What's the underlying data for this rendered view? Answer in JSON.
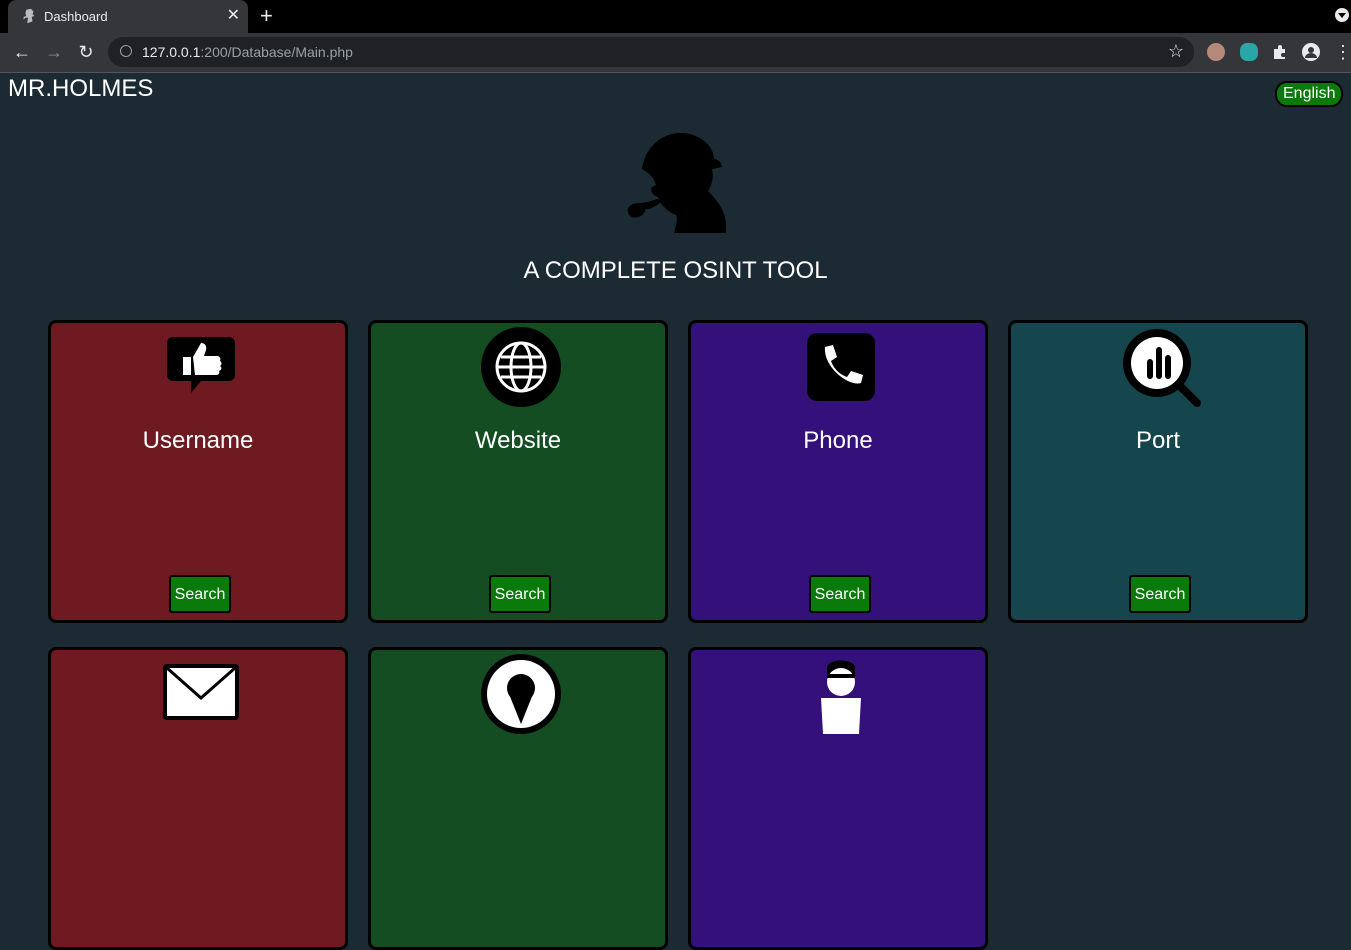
{
  "browser": {
    "tab_title": "Dashboard",
    "url_host": "127.0.0.1",
    "url_rest": ":200/Database/Main.php"
  },
  "header": {
    "brand": "MR.HOLMES",
    "language_button": "English"
  },
  "hero": {
    "subtitle": "A COMPLETE OSINT TOOL"
  },
  "cards": [
    {
      "title": "Username",
      "button": "Search",
      "icon": "thumbs-up-speech-icon",
      "color": "#6e1a20"
    },
    {
      "title": "Website",
      "button": "Search",
      "icon": "globe-icon",
      "color": "#134d21"
    },
    {
      "title": "Phone",
      "button": "Search",
      "icon": "phone-icon",
      "color": "#33107a"
    },
    {
      "title": "Port",
      "button": "Search",
      "icon": "search-chart-icon",
      "color": "#15464d"
    }
  ],
  "lower_cards": [
    {
      "icon": "envelope-icon",
      "color": "#6e1a20"
    },
    {
      "icon": "location-pin-icon",
      "color": "#134d21"
    },
    {
      "icon": "person-icon",
      "color": "#33107a"
    }
  ]
}
